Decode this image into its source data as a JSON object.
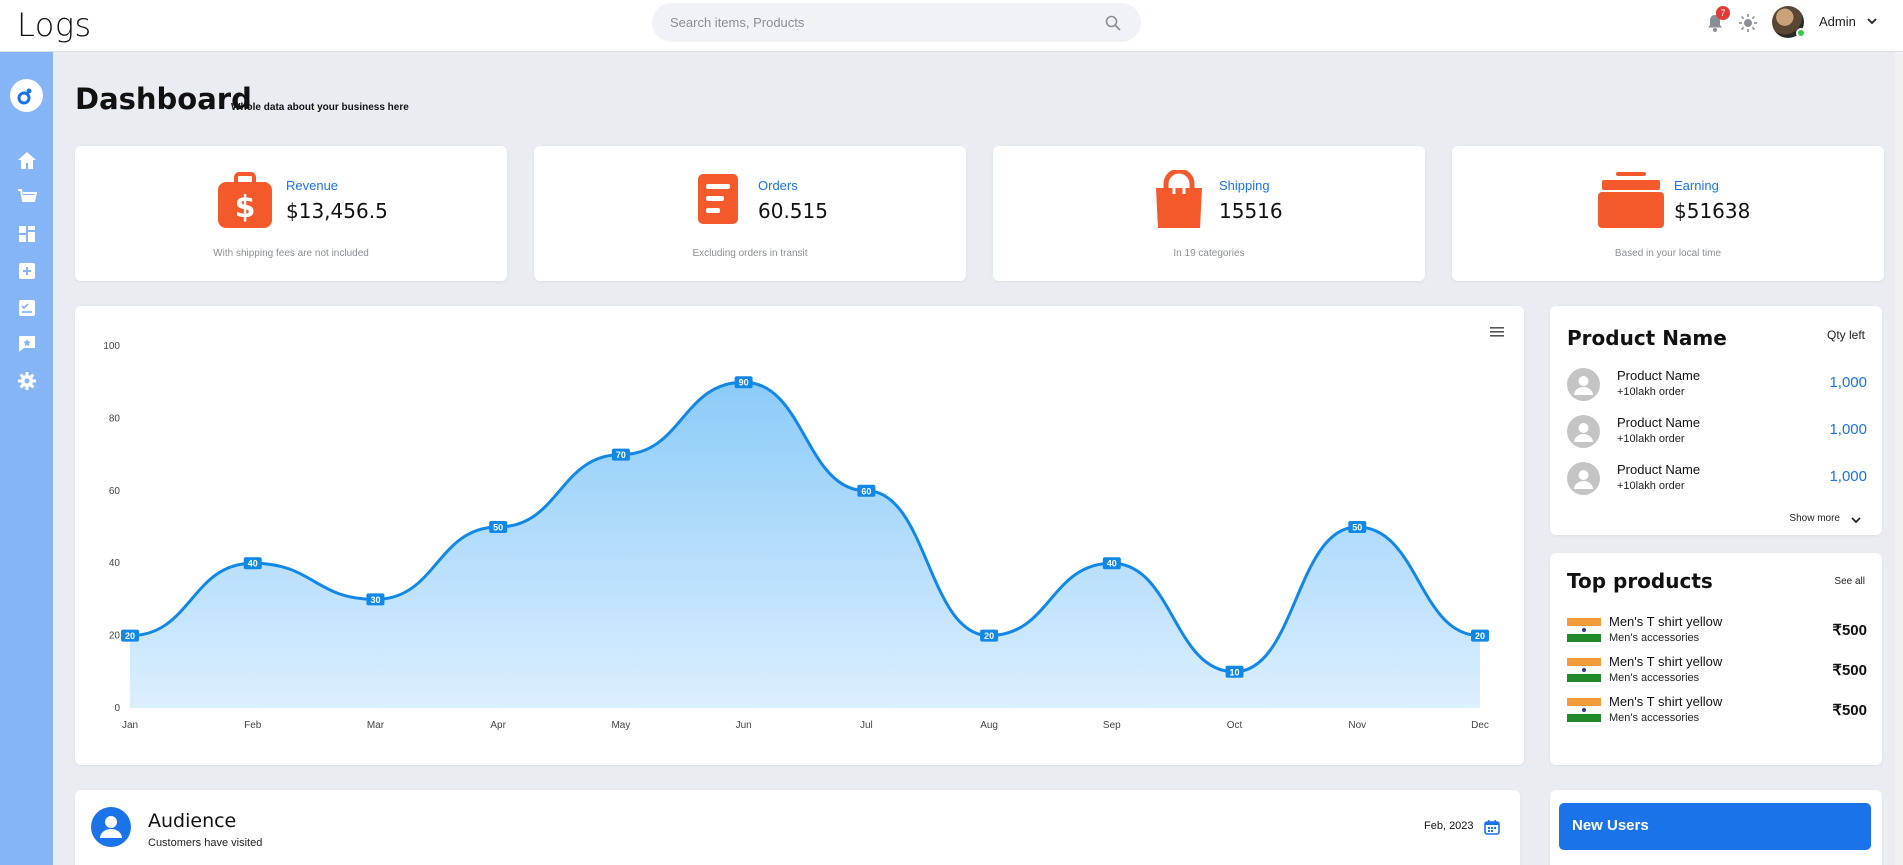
{
  "header": {
    "logo": "Logs",
    "search_placeholder": "Search items, Products",
    "notifications_count": "7",
    "user_name": "Admin"
  },
  "sidebar": {
    "items": [
      {
        "icon": "home-icon"
      },
      {
        "icon": "cart-icon"
      },
      {
        "icon": "grid-icon"
      },
      {
        "icon": "add-box-icon"
      },
      {
        "icon": "checklist-icon"
      },
      {
        "icon": "review-icon"
      },
      {
        "icon": "settings-icon"
      }
    ]
  },
  "page": {
    "title": "Dashboard",
    "subtitle": "Whole data about your business here"
  },
  "stats": [
    {
      "label": "Revenue",
      "value": "$13,456.5",
      "note": "With shipping fees are not included",
      "icon": "dollar-bag-icon"
    },
    {
      "label": "Orders",
      "value": "60.515",
      "note": "Excluding orders in transit",
      "icon": "document-list-icon"
    },
    {
      "label": "Shipping",
      "value": "15516",
      "note": "In 19 categories",
      "icon": "shopping-bag-icon"
    },
    {
      "label": "Earning",
      "value": "$51638",
      "note": "Based in your local time",
      "icon": "briefcase-icon"
    }
  ],
  "colors": {
    "accent": "#1a73e8",
    "icon_orange": "#f4592c",
    "sidebar": "#85b5f7",
    "line": "#1187e6"
  },
  "chart_data": {
    "type": "area",
    "categories": [
      "Jan",
      "Feb",
      "Mar",
      "Apr",
      "May",
      "Jun",
      "Jul",
      "Aug",
      "Sep",
      "Oct",
      "Nov",
      "Dec"
    ],
    "values": [
      20,
      40,
      30,
      50,
      70,
      90,
      60,
      20,
      40,
      10,
      50,
      20
    ],
    "ylim": [
      0,
      100
    ],
    "yticks": [
      0,
      20,
      40,
      60,
      80,
      100
    ],
    "data_labels": true,
    "grid": false,
    "legend": false
  },
  "products": {
    "title": "Product Name",
    "qty_header": "Qty left",
    "rows": [
      {
        "name": "Product Name",
        "sub": "+10lakh order",
        "qty": "1,000"
      },
      {
        "name": "Product Name",
        "sub": "+10lakh order",
        "qty": "1,000"
      },
      {
        "name": "Product Name",
        "sub": "+10lakh order",
        "qty": "1,000"
      }
    ],
    "show_more": "Show more"
  },
  "top_products": {
    "title": "Top products",
    "see_all": "See all",
    "rows": [
      {
        "name": "Men's T shirt yellow",
        "sub": "Men's accessories",
        "price": "₹500"
      },
      {
        "name": "Men's T shirt yellow",
        "sub": "Men's accessories",
        "price": "₹500"
      },
      {
        "name": "Men's T shirt yellow",
        "sub": "Men's accessories",
        "price": "₹500"
      }
    ]
  },
  "audience": {
    "title": "Audience",
    "subtitle": "Customers have visited",
    "date": "Feb, 2023"
  },
  "new_users": {
    "label": "New Users"
  }
}
